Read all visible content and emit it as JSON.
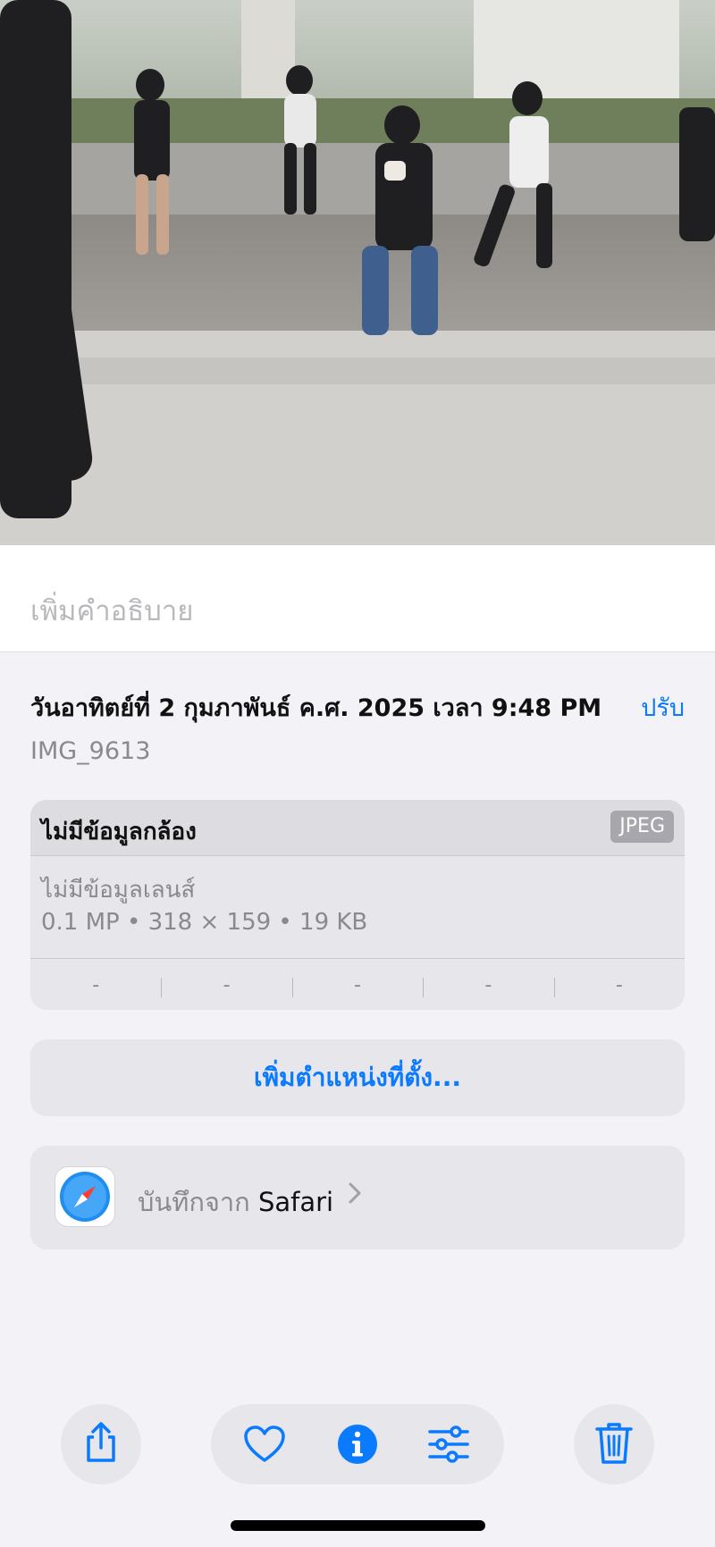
{
  "caption": {
    "placeholder": "เพิ่มคำอธิบาย"
  },
  "info": {
    "date_time": "วันอาทิตย์ที่ 2 กุมภาพันธ์ ค.ศ. 2025 เวลา 9:48 PM",
    "adjust_label": "ปรับ",
    "filename": "IMG_9613"
  },
  "metadata": {
    "camera": "ไม่มีข้อมูลกล้อง",
    "format": "JPEG",
    "lens": "ไม่มีข้อมูลเลนส์",
    "specs": "0.1 MP • 318 × 159 • 19 KB",
    "exif_values": [
      "-",
      "-",
      "-",
      "-",
      "-"
    ]
  },
  "location": {
    "label": "เพิ่มตำแหน่งที่ตั้ง..."
  },
  "source": {
    "prefix": "บันทึกจาก",
    "app": "Safari",
    "icon": "safari-icon"
  },
  "toolbar": {
    "icons": [
      "share-icon",
      "heart-icon",
      "info-icon",
      "adjust-sliders-icon",
      "trash-icon"
    ],
    "accent": "#0a7aff"
  }
}
